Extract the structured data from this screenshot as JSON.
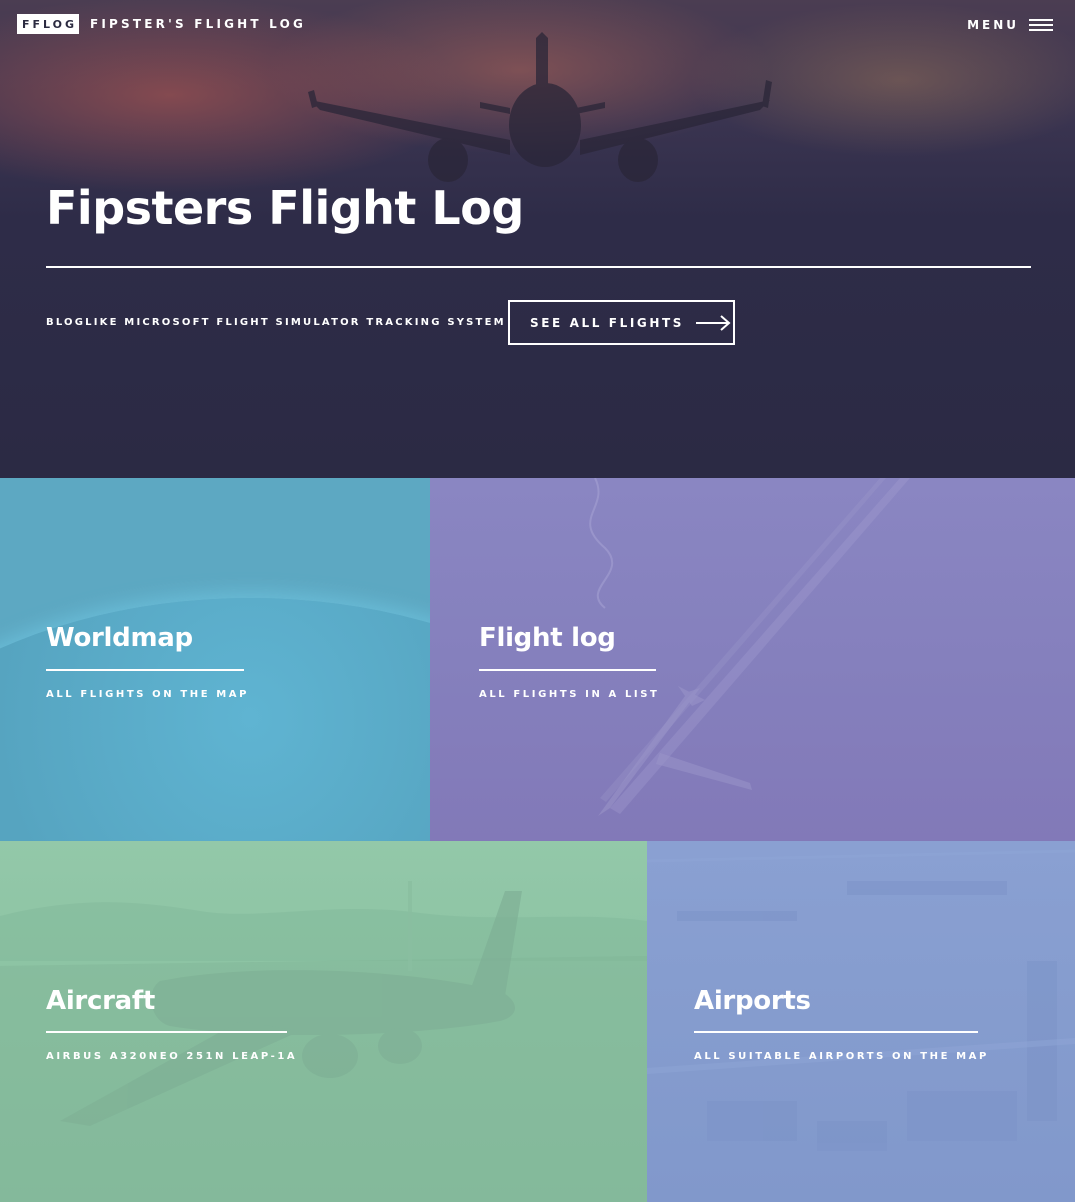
{
  "header": {
    "logo": "FFLOG",
    "site_name": "FIPSTER'S FLIGHT LOG",
    "menu_label": "MENU"
  },
  "hero": {
    "title": "Fipsters Flight Log",
    "subtitle": "BLOGLIKE MICROSOFT FLIGHT SIMULATOR TRACKING SYSTEM",
    "cta_label": "SEE ALL FLIGHTS",
    "cta_icon": "arrow-right-icon"
  },
  "tiles": [
    {
      "title": "Worldmap",
      "subtitle": "ALL FLIGHTS ON THE MAP",
      "color": "#5da8c2"
    },
    {
      "title": "Flight log",
      "subtitle": "ALL FLIGHTS IN A LIST",
      "color": "#8680bd"
    },
    {
      "title": "Aircraft",
      "subtitle": "AIRBUS A320NEO 251N LEAP-1A",
      "color": "#8cc3a3"
    },
    {
      "title": "Airports",
      "subtitle": "ALL SUITABLE AIRPORTS ON THE MAP",
      "color": "#859cce"
    }
  ],
  "colors": {
    "banner": "#2b2a44",
    "text": "#ffffff"
  }
}
